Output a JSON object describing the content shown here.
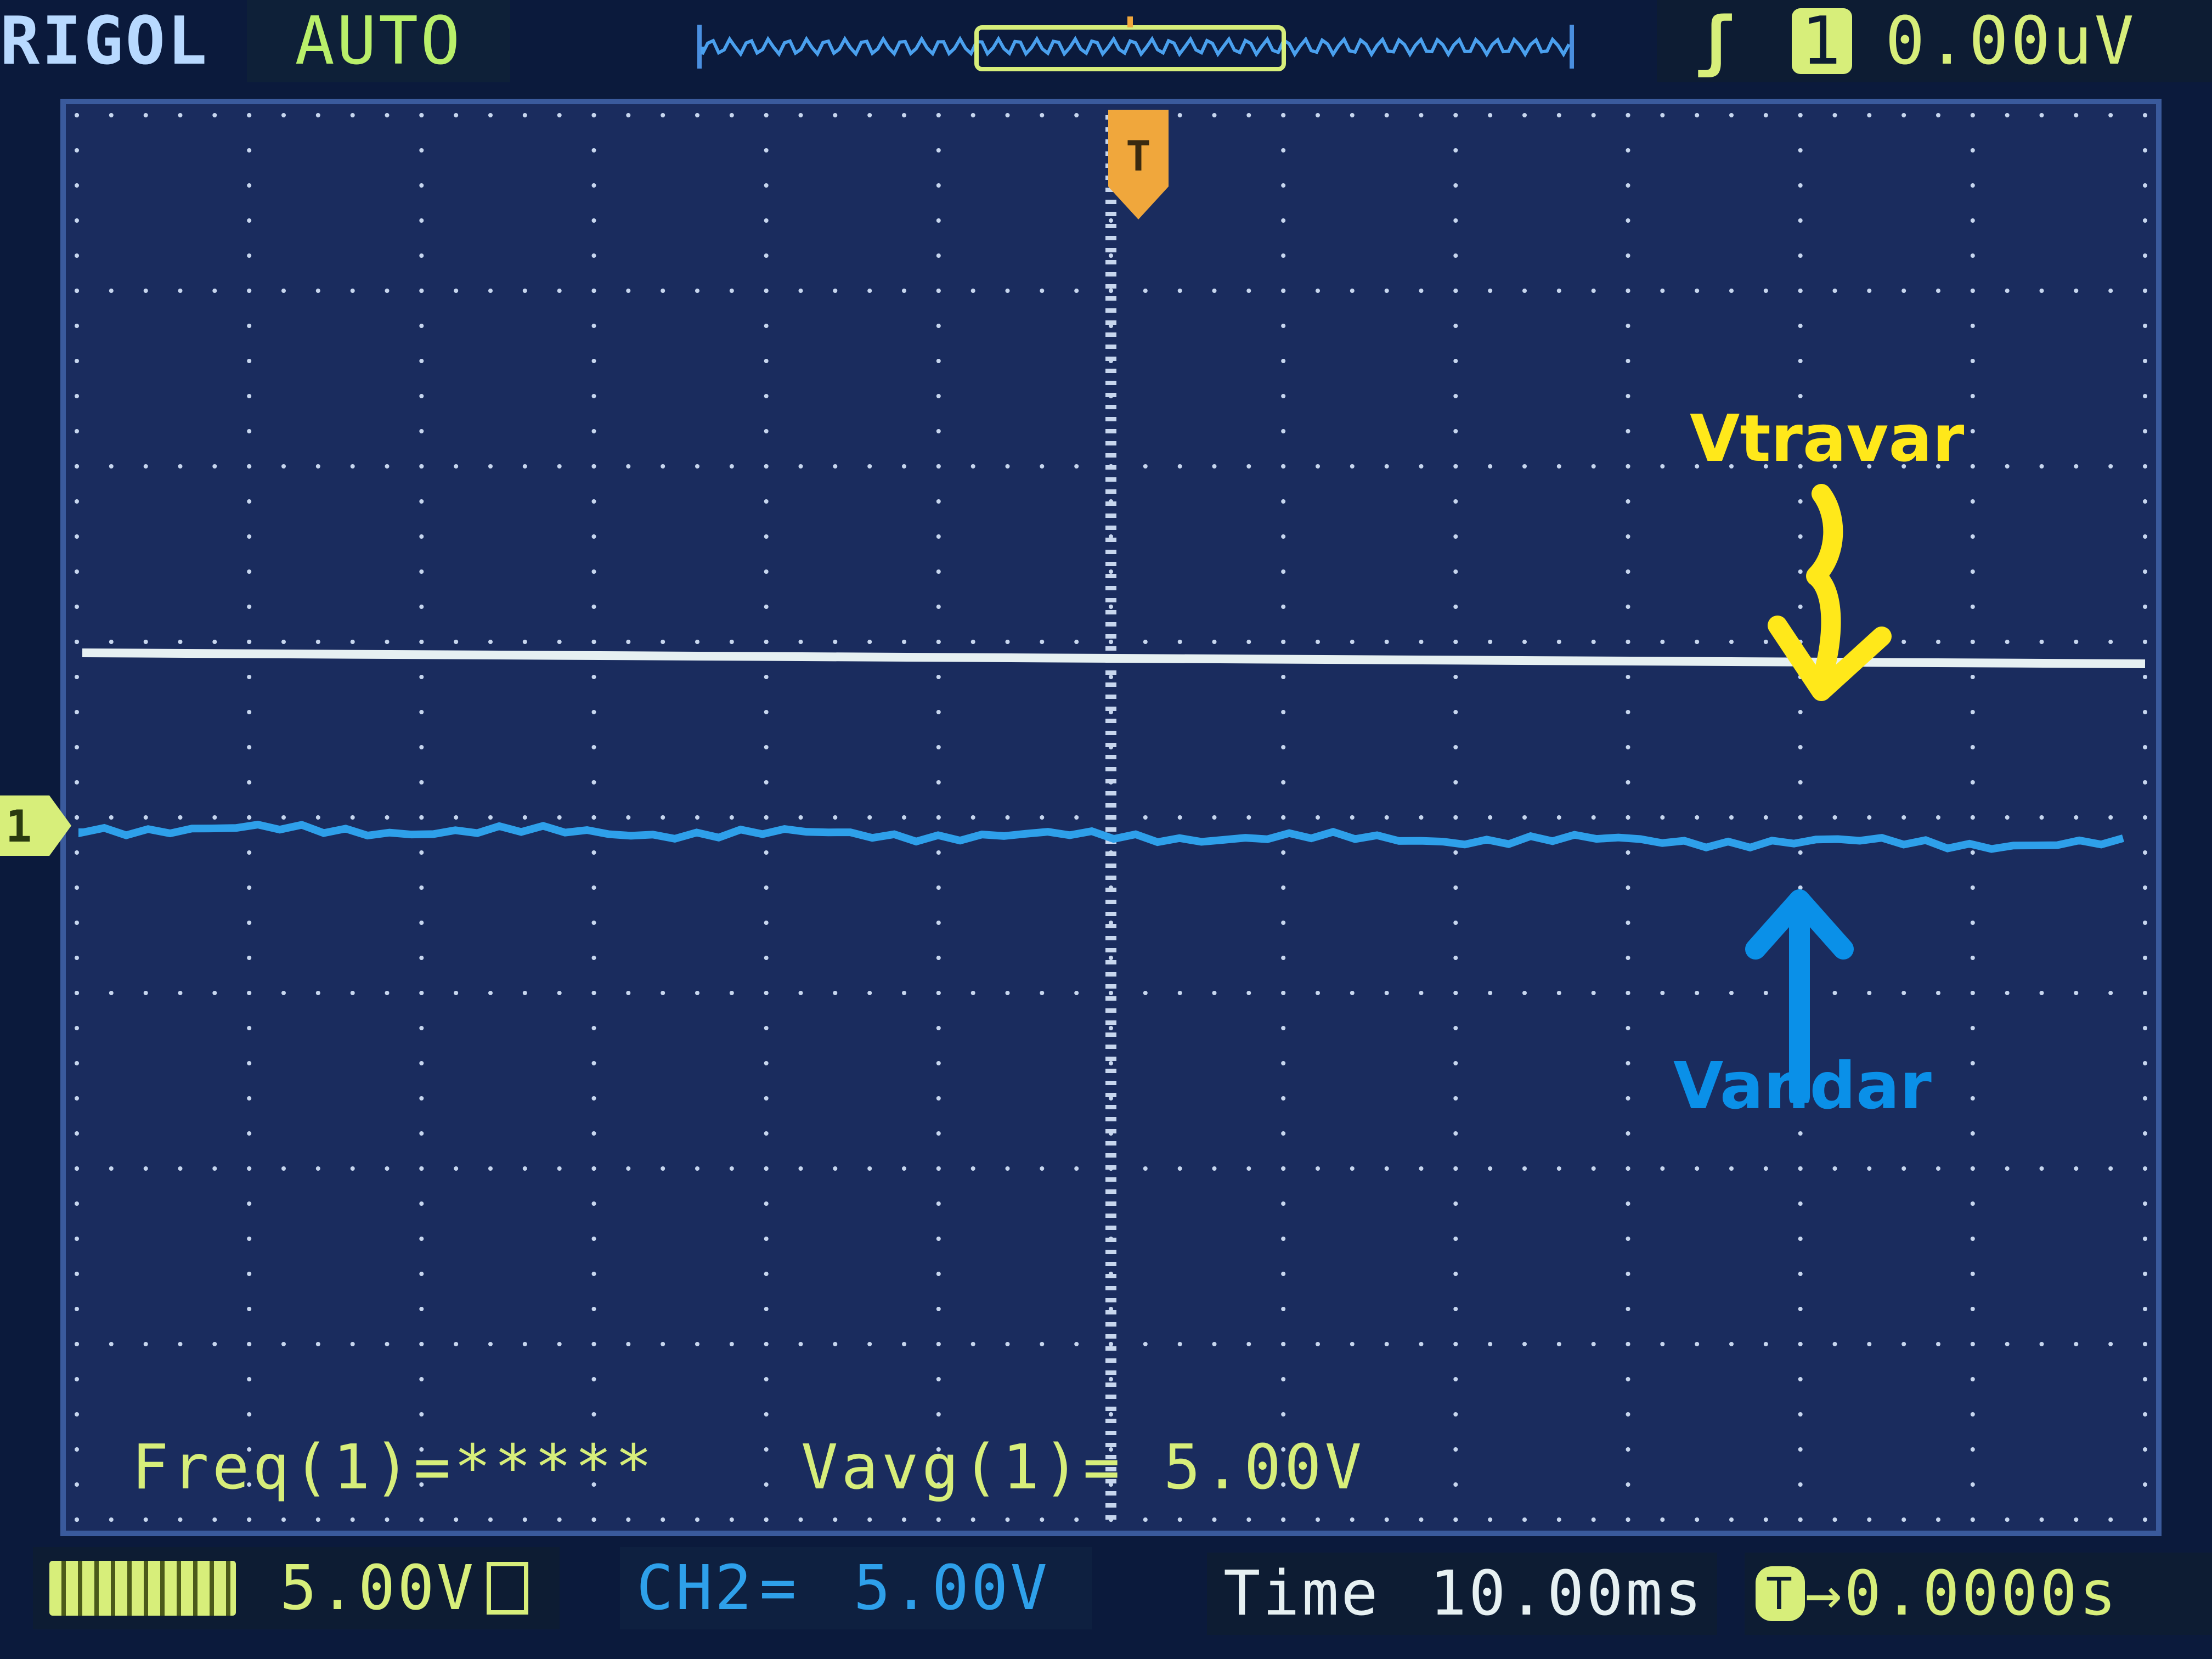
{
  "brand": "RIGOL",
  "trigger_mode": "AUTO",
  "trigger_status": {
    "edge_icon": "rising-edge-icon",
    "source": "1",
    "level": "0.00uV"
  },
  "measurements": {
    "freq": "Freq(1)=*****",
    "vavg": "Vavg(1)= 5.00V"
  },
  "status_bar": {
    "ch1_scale": "5.00V",
    "ch2_label": "CH2",
    "ch2_scale": "5.00V",
    "time_label": "Time",
    "time_scale": "10.00ms",
    "offset_value": "0.0000s"
  },
  "annotations": {
    "upper_trace_label": "Vtravar",
    "lower_trace_label": "Vandar"
  },
  "markers": {
    "trigger_position": "T",
    "ch1_marker": "1"
  },
  "colors": {
    "screen_bg": "#1a2c5e",
    "text_yellow": "#d7ee7a",
    "trace_white": "#e6f0f2",
    "trace_blue": "#2ea0ea",
    "annotation_yellow": "#ffe81a",
    "annotation_blue": "#0a90e8",
    "trigger_orange": "#f0a73c"
  }
}
